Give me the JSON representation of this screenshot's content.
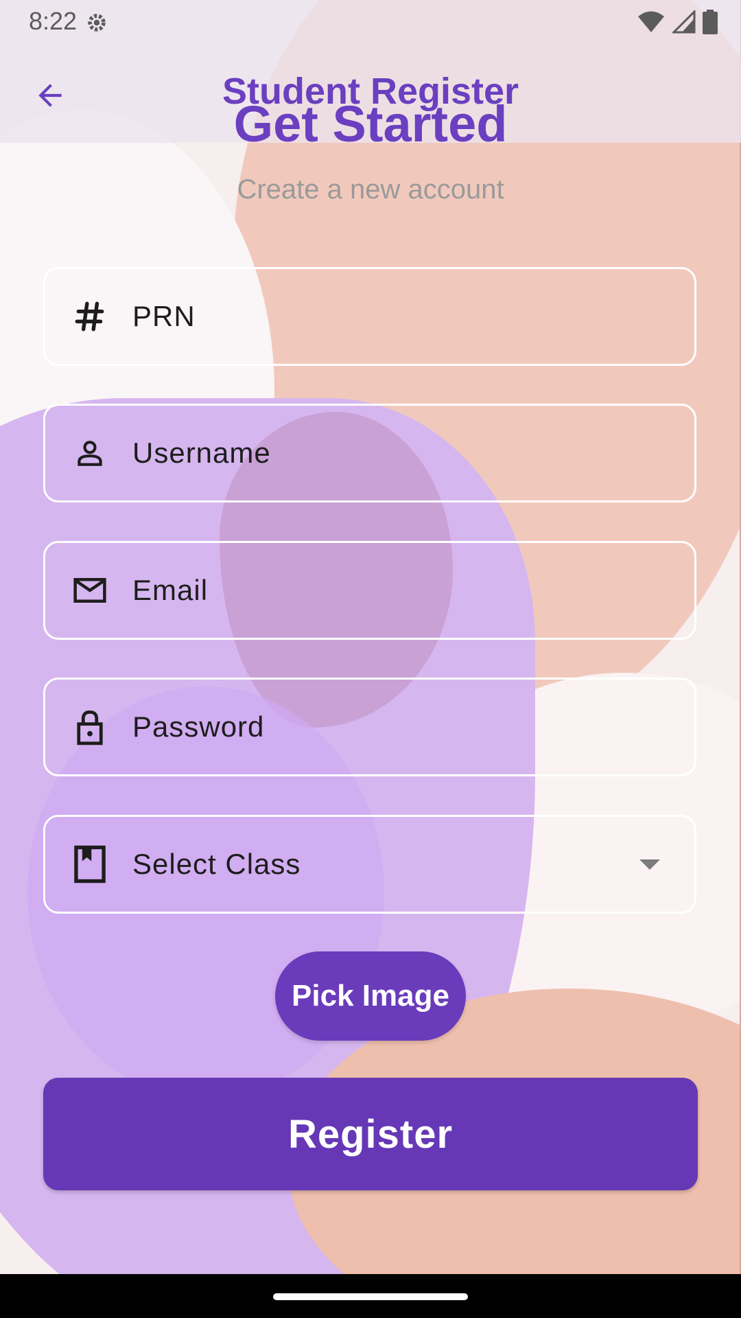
{
  "status_bar": {
    "time": "8:22"
  },
  "app_bar": {
    "title": "Student Register"
  },
  "header": {
    "headline": "Get Started",
    "subtitle": "Create a new account"
  },
  "form": {
    "fields": [
      {
        "label": "PRN",
        "icon": "hash-icon"
      },
      {
        "label": "Username",
        "icon": "person-icon"
      },
      {
        "label": "Email",
        "icon": "mail-icon"
      },
      {
        "label": "Password",
        "icon": "lock-icon"
      },
      {
        "label": "Select Class",
        "icon": "bookmark-book-icon"
      }
    ],
    "pick_image_label": "Pick Image",
    "register_label": "Register"
  },
  "colors": {
    "primary": "#6a3bbb",
    "title": "#6a3fc0",
    "subtitle": "#9a9a9a"
  }
}
